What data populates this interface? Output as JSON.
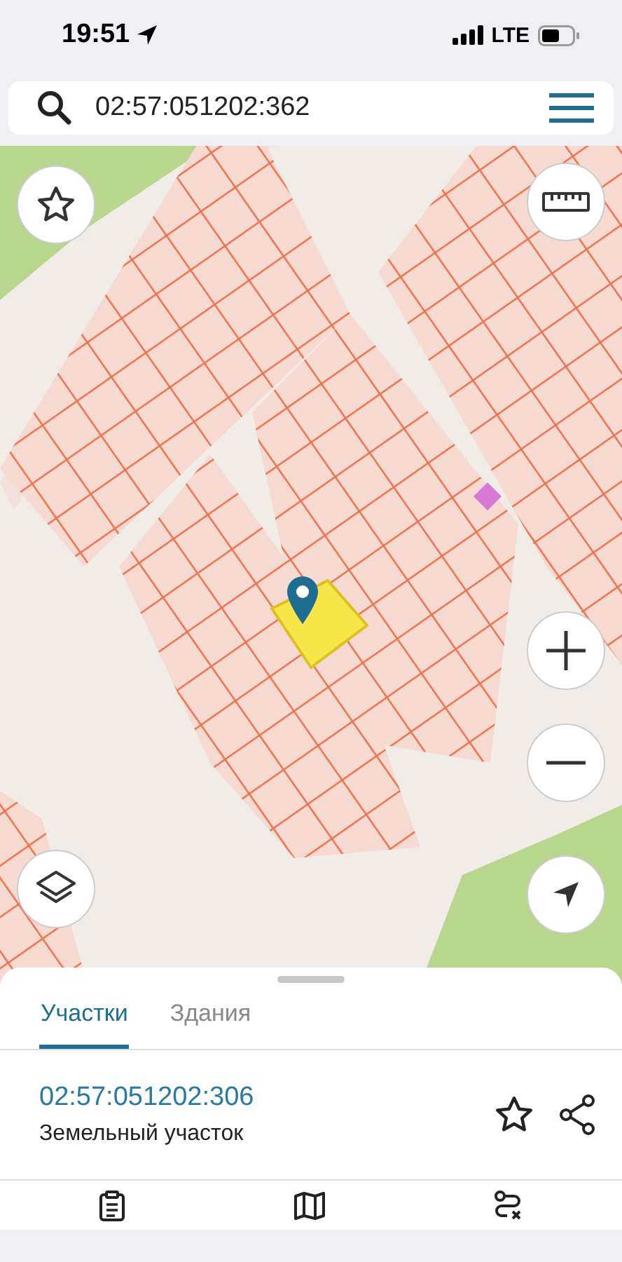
{
  "status_bar": {
    "time": "19:51",
    "network": "LTE"
  },
  "search": {
    "value": "02:57:051202:362"
  },
  "tabs": [
    {
      "label": "Участки",
      "selected": true
    },
    {
      "label": "Здания",
      "selected": false
    }
  ],
  "result": {
    "number": "02:57:051202:306",
    "type": "Земельный участок"
  }
}
